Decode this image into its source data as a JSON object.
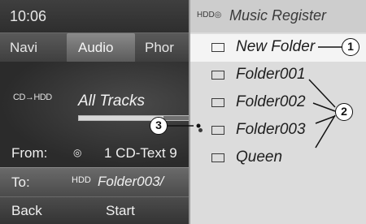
{
  "status": {
    "time": "10:06"
  },
  "menu": {
    "navi": "Navi",
    "audio": "Audio",
    "phone": "Phor"
  },
  "content": {
    "source_icons": "CD→HDD",
    "all_tracks": "All Tracks",
    "progress": 0.75,
    "from_label": "From:",
    "from_value": "1 CD-Text 9"
  },
  "to": {
    "label": "To:",
    "value": "Folder003/"
  },
  "softkeys": {
    "back": "Back",
    "start": "Start"
  },
  "register": {
    "title": "Music Register",
    "folders": [
      {
        "label": "New Folder",
        "selected": true
      },
      {
        "label": "Folder001"
      },
      {
        "label": "Folder002"
      },
      {
        "label": "Folder003",
        "marked": true
      },
      {
        "label": "Queen"
      }
    ]
  },
  "callouts": [
    "1",
    "2",
    "3"
  ]
}
